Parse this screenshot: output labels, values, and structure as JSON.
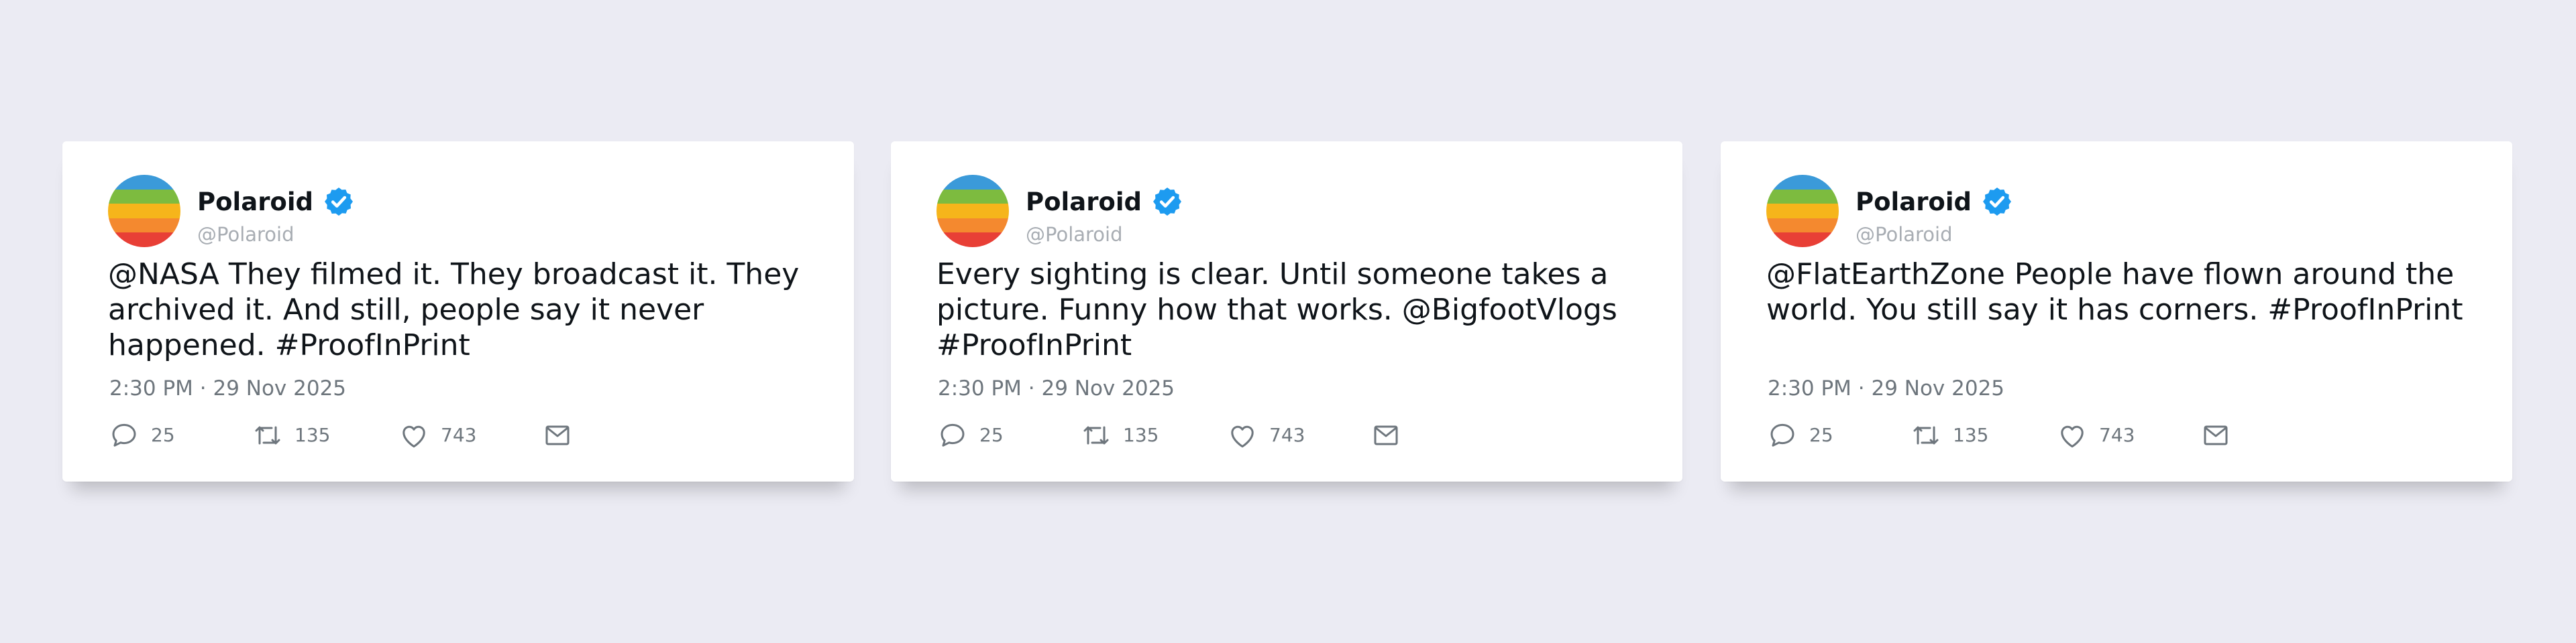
{
  "colors": {
    "background": "#ebebf3",
    "card": "#ffffff",
    "verified_badge": "#1d9bf0",
    "text": "#0f1419",
    "muted": "#6e767d",
    "handle": "#a8adb3",
    "avatar_stripes": [
      "#3b9ad9",
      "#7dbb3f",
      "#f6b51b",
      "#f4892f",
      "#e83f36"
    ]
  },
  "icons": {
    "verified": "verified-badge-icon",
    "reply": "reply-bubble-icon",
    "retweet": "retweet-icon",
    "like": "heart-icon",
    "share": "envelope-icon"
  },
  "tweets": [
    {
      "display_name": "Polaroid",
      "handle": "@Polaroid",
      "text": "@NASA They filmed it. They broadcast it. They archived it. And still, people say it never happened. #ProofInPrint",
      "timestamp": "2:30 PM · 29 Nov 2025",
      "replies": "25",
      "retweets": "135",
      "likes": "743"
    },
    {
      "display_name": "Polaroid",
      "handle": "@Polaroid",
      "text": "Every sighting is clear. Until someone takes a picture. Funny how that works. @BigfootVlogs #ProofInPrint",
      "timestamp": "2:30 PM · 29 Nov 2025",
      "replies": "25",
      "retweets": "135",
      "likes": "743"
    },
    {
      "display_name": "Polaroid",
      "handle": "@Polaroid",
      "text": "@FlatEarthZone People have flown around the world. You still say it has corners. #ProofInPrint",
      "timestamp": "2:30 PM · 29 Nov 2025",
      "replies": "25",
      "retweets": "135",
      "likes": "743"
    }
  ]
}
